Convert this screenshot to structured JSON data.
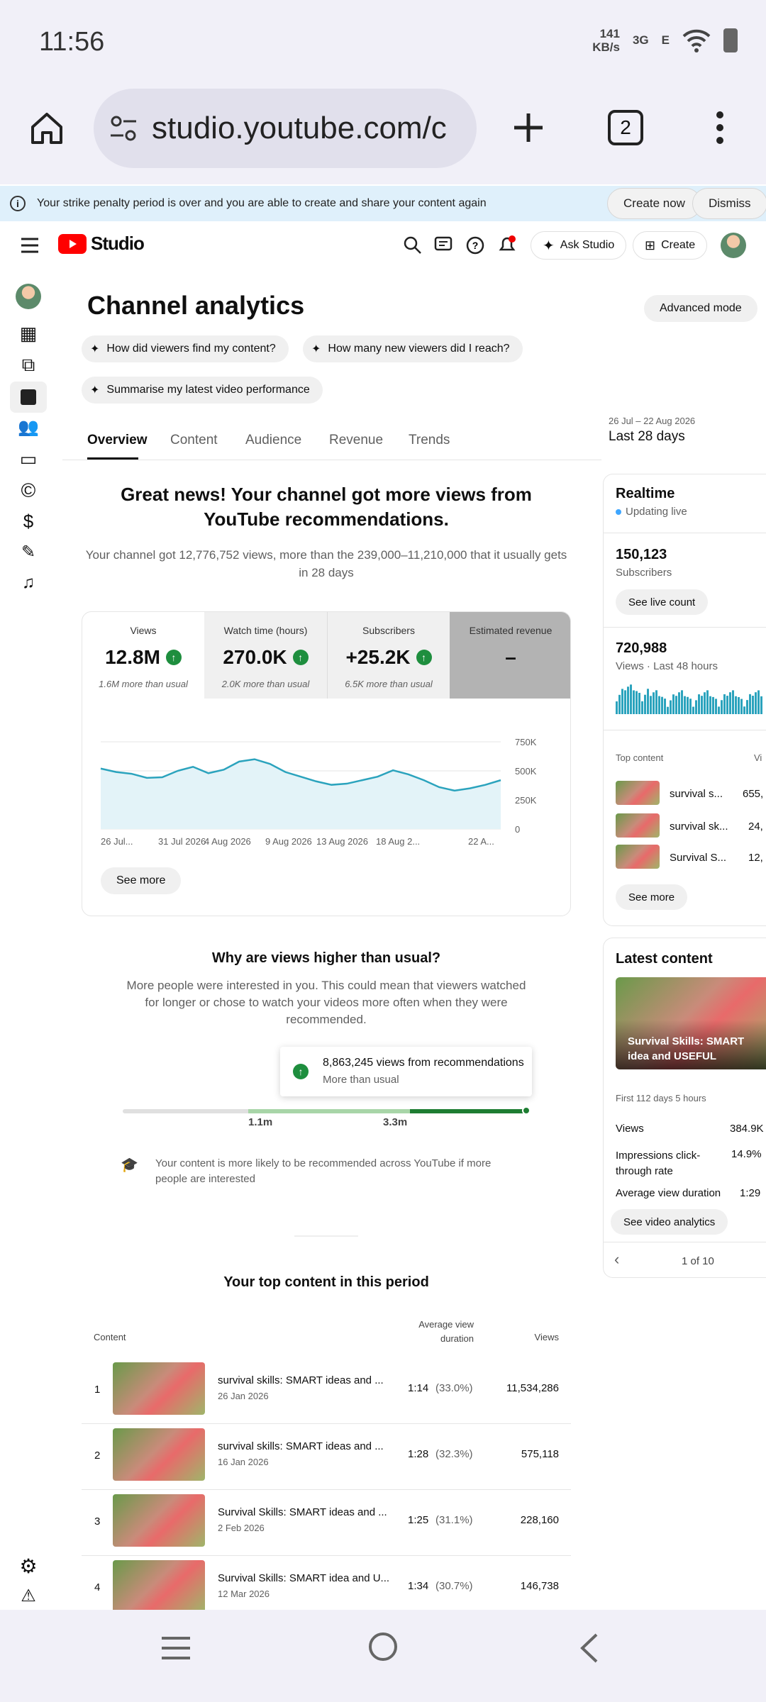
{
  "status": {
    "time": "11:56",
    "speed_value": "141",
    "speed_unit": "KB/s",
    "net1": "3G",
    "net2": "E"
  },
  "browser": {
    "url": "studio.youtube.com/c",
    "tab_count": "2"
  },
  "banner": {
    "text": "Your strike penalty period is over and you are able to create and share your content again",
    "create": "Create now",
    "dismiss": "Dismiss"
  },
  "topbar": {
    "logo": "Studio",
    "ask": "Ask Studio",
    "create": "Create"
  },
  "page": {
    "title": "Channel analytics",
    "advanced": "Advanced mode",
    "prompts": [
      "How did viewers find my content?",
      "How many new viewers did I reach?",
      "Summarise my latest video performance"
    ],
    "tabs": [
      "Overview",
      "Content",
      "Audience",
      "Revenue",
      "Trends"
    ],
    "date_range": "26 Jul – 22 Aug 2026",
    "period": "Last 28 days"
  },
  "summary": {
    "headline": "Great news! Your channel got more views from YouTube recommendations.",
    "body": "Your channel got 12,776,752 views, more than the 239,000–11,210,000 that it usually gets in 28 days"
  },
  "metrics": [
    {
      "label": "Views",
      "value": "12.8M",
      "sub": "1.6M more than usual"
    },
    {
      "label": "Watch time (hours)",
      "value": "270.0K",
      "sub": "2.0K more than usual"
    },
    {
      "label": "Subscribers",
      "value": "+25.2K",
      "sub": "6.5K more than usual"
    },
    {
      "label": "Estimated revenue",
      "value": "–",
      "sub": ""
    }
  ],
  "chart_data": {
    "type": "line",
    "x": [
      "26 Jul...",
      "31 Jul 2026",
      "4 Aug 2026",
      "9 Aug 2026",
      "13 Aug 2026",
      "18 Aug 2...",
      "22 A..."
    ],
    "values": [
      520,
      490,
      475,
      440,
      445,
      500,
      535,
      480,
      510,
      580,
      600,
      560,
      490,
      450,
      410,
      380,
      390,
      420,
      450,
      505,
      470,
      420,
      360,
      330,
      350,
      380,
      420
    ],
    "yticks": [
      "750K",
      "500K",
      "250K",
      "0"
    ],
    "ylim": [
      0,
      750
    ],
    "grid": true
  },
  "see_more": "See more",
  "why": {
    "title": "Why are views higher than usual?",
    "body": "More people were interested in you. This could mean that viewers watched for longer or chose to watch your videos more often when they were recommended.",
    "tip_value": "8,863,245 views from recommendations",
    "tip_sub": "More than usual",
    "mark1": "1.1m",
    "mark2": "3.3m",
    "note": "Your content is more likely to be recommended across YouTube if more people are interested"
  },
  "top": {
    "title": "Your top content in this period",
    "col_content": "Content",
    "col_avd": "Average view duration",
    "col_views": "Views",
    "rows": [
      {
        "n": "1",
        "title": "survival skills: SMART ideas and ...",
        "date": "26 Jan 2026",
        "avd": "1:14",
        "pct": "(33.0%)",
        "views": "11,534,286"
      },
      {
        "n": "2",
        "title": "survival skills: SMART ideas and ...",
        "date": "16 Jan 2026",
        "avd": "1:28",
        "pct": "(32.3%)",
        "views": "575,118"
      },
      {
        "n": "3",
        "title": "Survival Skills: SMART ideas and ...",
        "date": "2 Feb 2026",
        "avd": "1:25",
        "pct": "(31.1%)",
        "views": "228,160"
      },
      {
        "n": "4",
        "title": "Survival Skills: SMART idea and U...",
        "date": "12 Mar 2026",
        "avd": "1:34",
        "pct": "(30.7%)",
        "views": "146,738"
      }
    ]
  },
  "realtime": {
    "title": "Realtime",
    "live": "Updating live",
    "subs": "150,123",
    "subs_label": "Subscribers",
    "live_btn": "See live count",
    "views": "720,988",
    "views_label": "Views · Last 48 hours",
    "top_label": "Top content",
    "top_col": "Vi",
    "items": [
      {
        "t": "survival s...",
        "v": "655,"
      },
      {
        "t": "survival sk...",
        "v": "24,"
      },
      {
        "t": "Survival S...",
        "v": "12,"
      }
    ],
    "see_more": "See more"
  },
  "latest": {
    "title": "Latest content",
    "thumb_title": "Survival Skills: SMART idea and USEFUL #bushcraft...",
    "period": "First 112 days 5 hours",
    "stats": [
      {
        "k": "Views",
        "v": "384.9K"
      },
      {
        "k": "Impressions click-through rate",
        "v": "14.9%"
      },
      {
        "k": "Average view duration",
        "v": "1:29"
      }
    ],
    "btn": "See video analytics",
    "pager": "1 of 10"
  }
}
